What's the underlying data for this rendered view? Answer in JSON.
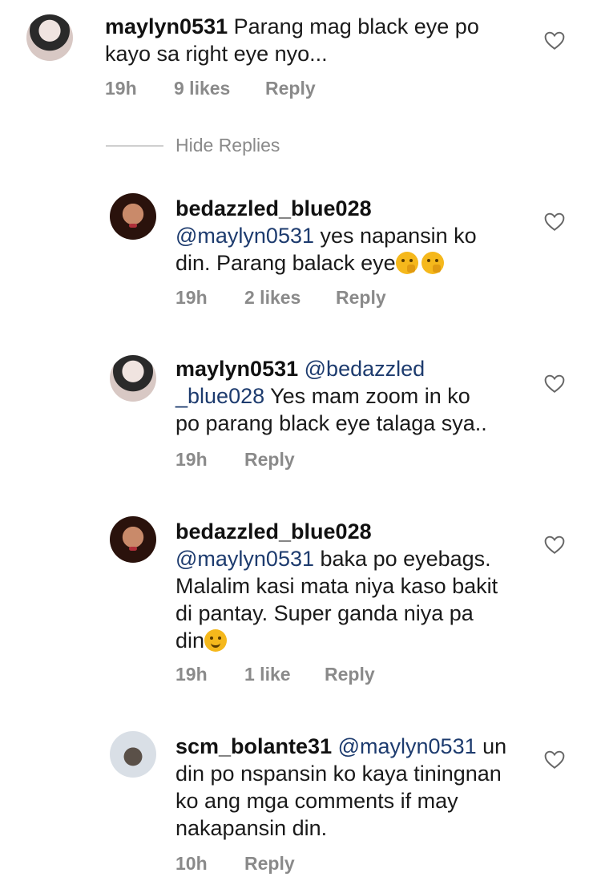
{
  "comments": [
    {
      "user": "maylyn0531",
      "mention": "",
      "text_line1": "Parang mag black eye po",
      "text_line2": "kayo sa right eye nyo...",
      "text_line3": "",
      "text_line4": "",
      "time": "19h",
      "likes": "9 likes",
      "reply": "Reply"
    },
    {
      "user": "bedazzled_blue028",
      "mention": "@maylyn0531",
      "text_line1": "yes napansin ko",
      "text_line2": "din. Parang balack eye",
      "text_line3": "",
      "text_line4": "",
      "time": "19h",
      "likes": "2 likes",
      "reply": "Reply"
    },
    {
      "user": "maylyn0531",
      "mention": "@bedazzled",
      "mention2": "_blue028",
      "text_line1": "Yes mam zoom in ko",
      "text_line2": "po parang black eye talaga sya..",
      "time": "19h",
      "likes": "",
      "reply": "Reply"
    },
    {
      "user": "bedazzled_blue028",
      "mention": "@maylyn0531",
      "text_line1": "baka po eyebags.",
      "text_line2": "Malalim kasi mata niya kaso bakit",
      "text_line3": "di pantay. Super ganda niya pa",
      "text_line4": "din",
      "time": "19h",
      "likes": "1 like",
      "reply": "Reply"
    },
    {
      "user": "scm_bolante31",
      "mention": "@maylyn0531",
      "text_line1": "un",
      "text_line2": "din po nspansin ko kaya tiningnan",
      "text_line3": "ko ang mga comments if may",
      "text_line4": "nakapansin din.",
      "time": "10h",
      "likes": "",
      "reply": "Reply"
    }
  ],
  "hide_replies": "Hide Replies",
  "icons": {
    "like": "heart-outline-icon",
    "emoji_think": "thinking-face-emoji",
    "emoji_smile": "smiling-face-emoji"
  },
  "colors": {
    "mention": "#1d3b6e",
    "meta": "#8a8a8a"
  }
}
